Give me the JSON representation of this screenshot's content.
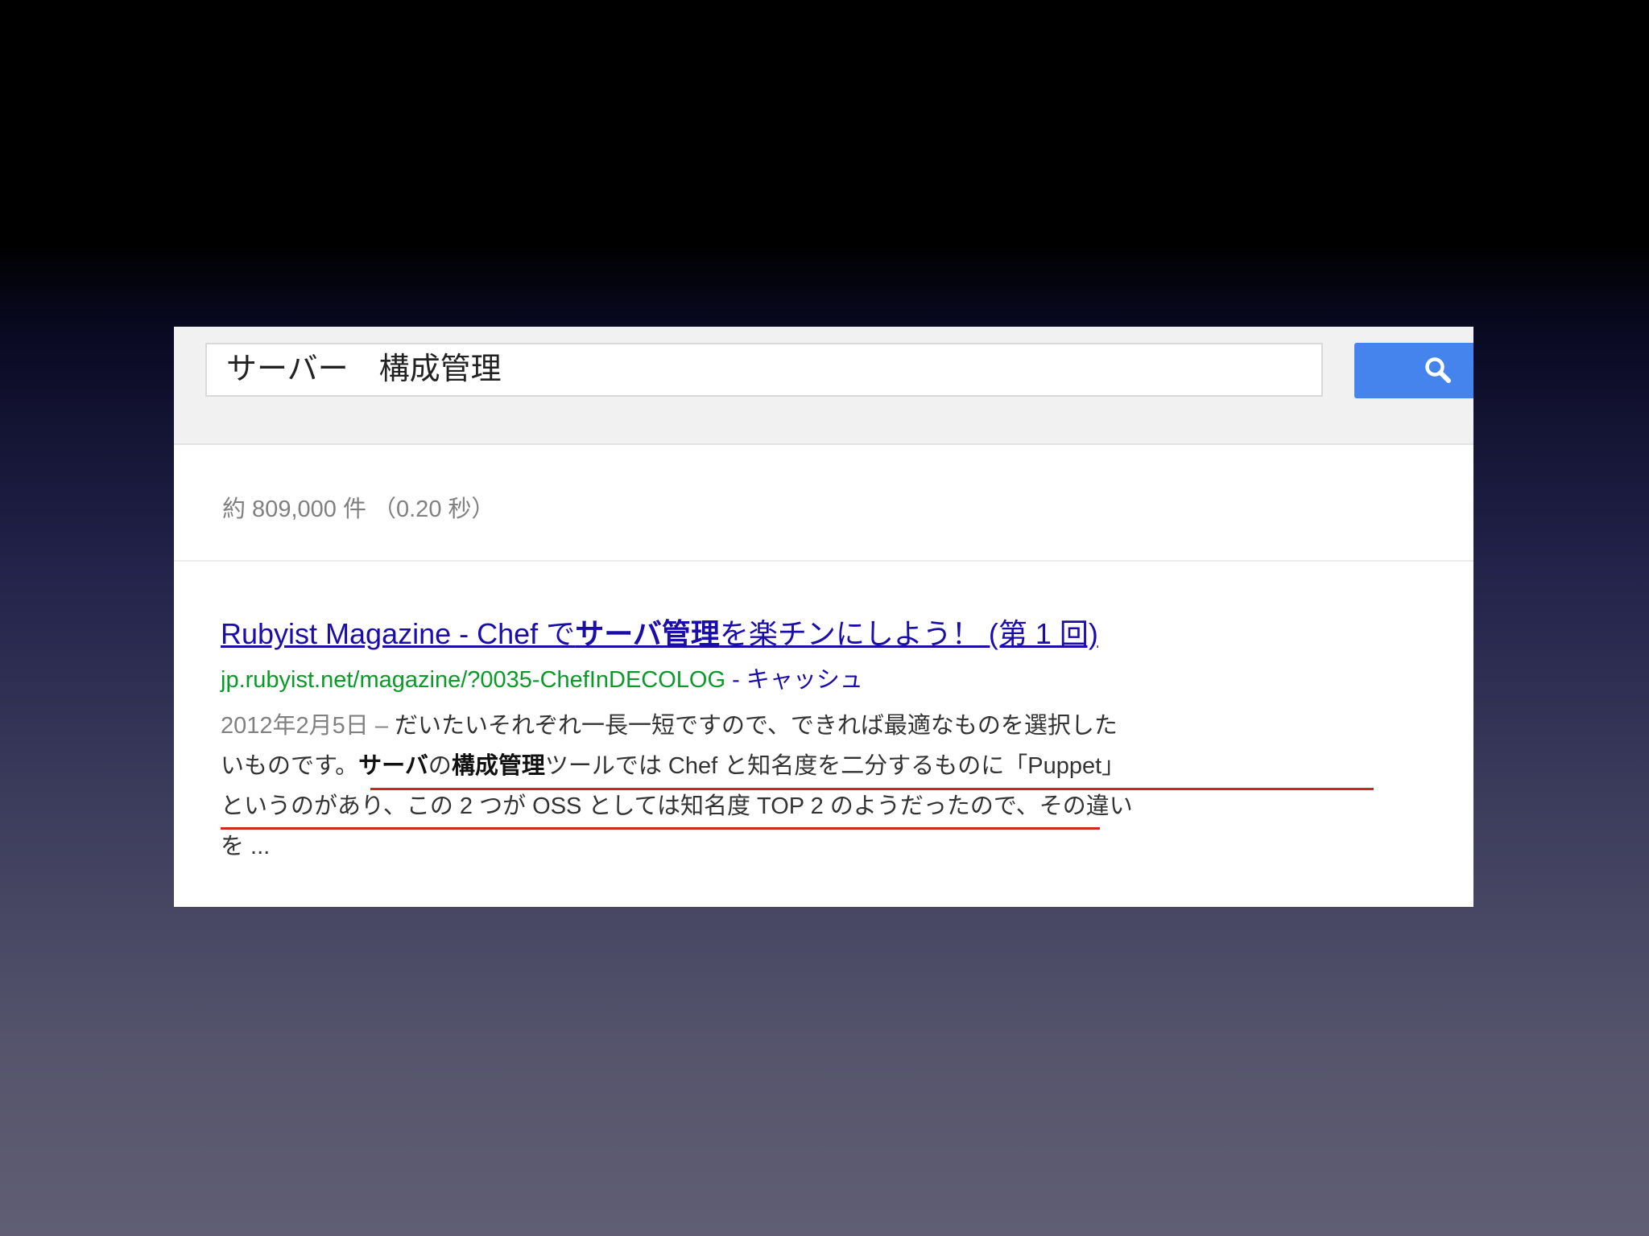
{
  "search": {
    "query": "サーバー　構成管理"
  },
  "stats": {
    "text": "約 809,000 件 （0.20 秒）"
  },
  "result": {
    "title_prefix": "Rubyist Magazine - Chef で",
    "title_bold": "サーバ管理",
    "title_suffix": "を楽チンにしよう！ (第 1 回)",
    "url": "jp.rubyist.net/magazine/?0035-ChefInDECOLOG",
    "cache_separator": " - ",
    "cache_label": "キャッシュ",
    "date": "2012年2月5日 – ",
    "snippet_line1": "だいたいそれぞれ一長一短ですので、できれば最適なものを選択した",
    "snippet_line2_prefix": "いものです。",
    "snippet_bold1": "サーバ",
    "snippet_no": "の",
    "snippet_bold2": "構成管理",
    "snippet_line2_suffix": "ツールでは Chef と知名度を二分するものに「Puppet」",
    "snippet_line3": "というのがあり、この 2 つが OSS としては知名度 TOP 2 のようだったので、その違い",
    "snippet_line4": "を ..."
  },
  "colors": {
    "accent_blue": "#4584ed",
    "link": "#1a0dab",
    "url_green": "#0a9a2a",
    "annotation_red": "#cc2a18"
  },
  "icons": {
    "search_button": "search-icon"
  }
}
